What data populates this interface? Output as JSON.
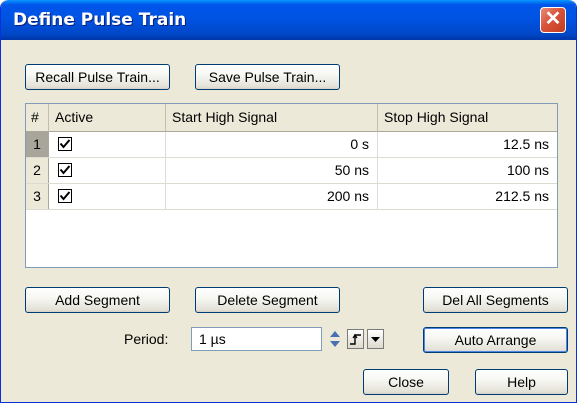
{
  "window": {
    "title": "Define Pulse Train",
    "close_glyph": "✕"
  },
  "toolbar": {
    "recall_label": "Recall Pulse Train...",
    "save_label": "Save Pulse Train..."
  },
  "table": {
    "headers": {
      "num": "#",
      "active": "Active",
      "start": "Start High Signal",
      "stop": "Stop High Signal"
    },
    "rows": [
      {
        "num": "1",
        "active": true,
        "start": "0 s",
        "stop": "12.5 ns"
      },
      {
        "num": "2",
        "active": true,
        "start": "50 ns",
        "stop": "100 ns"
      },
      {
        "num": "3",
        "active": true,
        "start": "200 ns",
        "stop": "212.5 ns"
      }
    ]
  },
  "buttons": {
    "add_segment": "Add Segment",
    "delete_segment": "Delete Segment",
    "del_all_segments": "Del All Segments",
    "auto_arrange": "Auto Arrange",
    "close": "Close",
    "help": "Help"
  },
  "period": {
    "label": "Period:",
    "value": "1 µs"
  },
  "icons": {
    "close": "close-icon",
    "checkbox": "checkmark-icon",
    "spinner": "spinner-icon",
    "pulse": "pulse-edge-icon",
    "dropdown": "chevron-down-icon"
  },
  "colors": {
    "title_bar": "#0054e3",
    "close_button": "#d8533a",
    "dialog_bg": "#ece9d8"
  }
}
